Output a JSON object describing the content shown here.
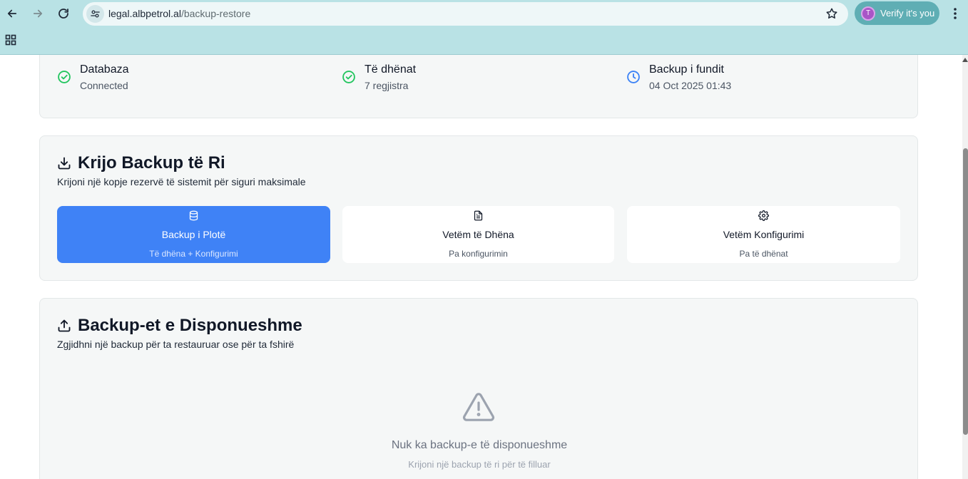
{
  "browser": {
    "url_host": "legal.albpetrol.al",
    "url_path": "/backup-restore",
    "profile_initial": "T",
    "profile_label": "Verify it's you"
  },
  "status": {
    "items": [
      {
        "label": "Databaza",
        "value": "Connected",
        "icon": "check-circle-icon",
        "color": "#22c55e"
      },
      {
        "label": "Të dhënat",
        "value": "7 regjistra",
        "icon": "check-circle-icon",
        "color": "#22c55e"
      },
      {
        "label": "Backup i fundit",
        "value": "04 Oct 2025 01:43",
        "icon": "clock-icon",
        "color": "#3b82f6"
      }
    ]
  },
  "create": {
    "title": "Krijo Backup të Ri",
    "subtitle": "Krijoni një kopje rezervë të sistemit për siguri maksimale",
    "options": [
      {
        "label": "Backup i Plotë",
        "sub": "Të dhëna + Konfigurimi",
        "icon": "database-icon",
        "selected": true
      },
      {
        "label": "Vetëm të Dhëna",
        "sub": "Pa konfigurimin",
        "icon": "file-text-icon",
        "selected": false
      },
      {
        "label": "Vetëm Konfigurimi",
        "sub": "Pa të dhënat",
        "icon": "gear-icon",
        "selected": false
      }
    ]
  },
  "available": {
    "title": "Backup-et e Disponueshme",
    "subtitle": "Zgjidhni një backup për ta restauruar ose për ta fshirë",
    "empty_title": "Nuk ka backup-e të disponueshme",
    "empty_sub": "Krijoni një backup të ri për të filluar"
  },
  "colors": {
    "accent": "#3f82f6",
    "chrome": "#b9e2e5",
    "success": "#22c55e"
  }
}
